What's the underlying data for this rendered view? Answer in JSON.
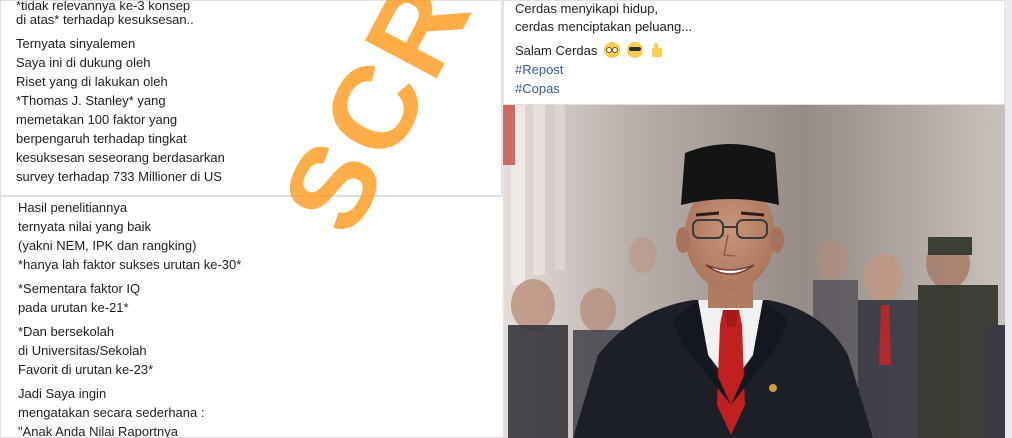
{
  "top_left": {
    "lines": [
      "*tidak relevannya ke-3 konsep",
      "di atas* terhadap kesuksesan..",
      "Ternyata sinyalemen",
      "Saya ini di dukung oleh",
      "Riset yang di lakukan oleh",
      "*Thomas J. Stanley* yang",
      "memetakan 100 faktor yang",
      "berpengaruh terhadap tingkat",
      "kesuksesan seseorang berdasarkan",
      "survey terhadap 733 Millioner di US"
    ]
  },
  "bottom_left": {
    "lines": [
      "Hasil penelitiannya",
      "ternyata nilai yang baik",
      "(yakni NEM, IPK dan rangking)",
      "*hanya lah faktor sukses urutan ke-30*",
      "*Sementara faktor IQ",
      "pada urutan ke-21*",
      "*Dan bersekolah",
      "di Universitas/Sekolah",
      "Favorit di urutan ke-23*",
      "Jadi Saya ingin",
      "mengatakan secara sederhana :",
      "\"Anak Anda Nilai Raportnya"
    ]
  },
  "top_right": {
    "lines": [
      "Cerdas menyikapi hidup,",
      "cerdas menciptakan peluang..."
    ],
    "greeting": "Salam Cerdas",
    "emojis": [
      "flushed-face-icon",
      "smiling-sunglasses-icon",
      "thumbs-up-icon"
    ],
    "hashtags": [
      "#Repost",
      "#Copas"
    ]
  },
  "watermark": "SCREENSHOT",
  "colors": {
    "hashtag": "#385898",
    "watermark": "#ff9614"
  }
}
